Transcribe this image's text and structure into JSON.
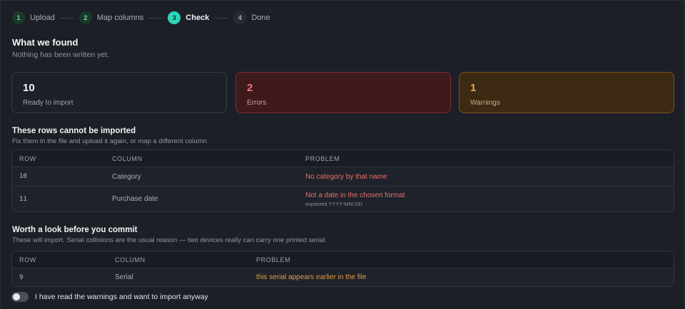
{
  "stepper": [
    {
      "num": "1",
      "label": "Upload",
      "state": "done"
    },
    {
      "num": "2",
      "label": "Map columns",
      "state": "done"
    },
    {
      "num": "3",
      "label": "Check",
      "state": "active"
    },
    {
      "num": "4",
      "label": "Done",
      "state": "todo"
    }
  ],
  "header": {
    "title": "What we found",
    "subtitle": "Nothing has been written yet."
  },
  "summary": {
    "ready": {
      "value": "10",
      "label": "Ready to import"
    },
    "errors": {
      "value": "2",
      "label": "Errors"
    },
    "warnings": {
      "value": "1",
      "label": "Warnings"
    }
  },
  "errors_section": {
    "title": "These rows cannot be imported",
    "subtitle": "Fix them in the file and upload it again, or map a different column.",
    "columns": [
      "ROW",
      "COLUMN",
      "PROBLEM"
    ],
    "rows": [
      {
        "row": "10",
        "column": "Category",
        "problem": "No category by that name",
        "hint": ""
      },
      {
        "row": "11",
        "column": "Purchase date",
        "problem": "Not a date in the chosen format",
        "hint": "expected YYYY-MM-DD"
      }
    ]
  },
  "warnings_section": {
    "title": "Worth a look before you commit",
    "subtitle": "These will import. Serial collisions are the usual reason — two devices really can carry one printed serial.",
    "columns": [
      "ROW",
      "COLUMN",
      "PROBLEM"
    ],
    "rows": [
      {
        "row": "9",
        "column": "Serial",
        "problem": "this serial appears earlier in the file"
      }
    ]
  },
  "confirm": {
    "label": "I have read the warnings and want to import anyway",
    "checked": false
  },
  "colors": {
    "accent": "#2fd3b7",
    "error": "#e6706d",
    "warning": "#e29b46"
  }
}
